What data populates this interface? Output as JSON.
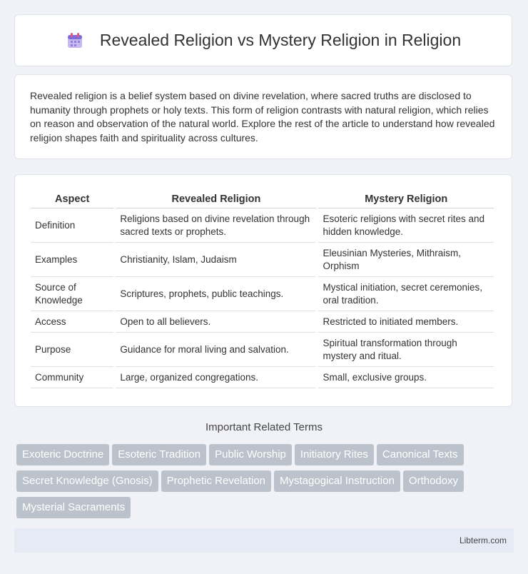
{
  "header": {
    "title": "Revealed Religion vs Mystery Religion in Religion",
    "icon": "calendar-icon"
  },
  "intro": {
    "text": "Revealed religion is a belief system based on divine revelation, where sacred truths are disclosed to humanity through prophets or holy texts. This form of religion contrasts with natural religion, which relies on reason and observation of the natural world. Explore the rest of the article to understand how revealed religion shapes faith and spirituality across cultures."
  },
  "table": {
    "headers": [
      "Aspect",
      "Revealed Religion",
      "Mystery Religion"
    ],
    "rows": [
      [
        "Definition",
        "Religions based on divine revelation through sacred texts or prophets.",
        "Esoteric religions with secret rites and hidden knowledge."
      ],
      [
        "Examples",
        "Christianity, Islam, Judaism",
        "Eleusinian Mysteries, Mithraism, Orphism"
      ],
      [
        "Source of Knowledge",
        "Scriptures, prophets, public teachings.",
        "Mystical initiation, secret ceremonies, oral tradition."
      ],
      [
        "Access",
        "Open to all believers.",
        "Restricted to initiated members."
      ],
      [
        "Purpose",
        "Guidance for moral living and salvation.",
        "Spiritual transformation through mystery and ritual."
      ],
      [
        "Community",
        "Large, organized congregations.",
        "Small, exclusive groups."
      ]
    ]
  },
  "related": {
    "title": "Important Related Terms",
    "terms": [
      "Exoteric Doctrine",
      "Esoteric Tradition",
      "Public Worship",
      "Initiatory Rites",
      "Canonical Texts",
      "Secret Knowledge (Gnosis)",
      "Prophetic Revelation",
      "Mystagogical Instruction",
      "Orthodoxy",
      "Mysterial Sacraments"
    ]
  },
  "footer": {
    "site": "Libterm.com"
  },
  "colors": {
    "tag_bg": "#bcc2cc",
    "page_bg": "#f0f2f7",
    "footer_bg": "#e5eaf5"
  }
}
